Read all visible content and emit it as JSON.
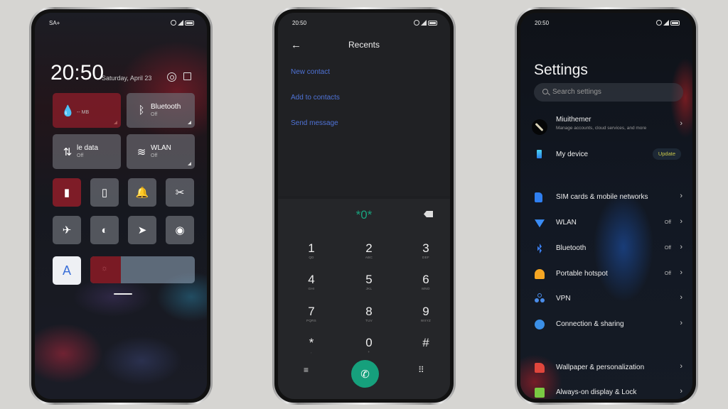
{
  "control_center": {
    "status_left": "SA+",
    "time": "20:50",
    "date": "Saturday, April 23",
    "icons": {
      "settings": "gear-icon",
      "edit": "edit-icon"
    },
    "tiles_large": [
      {
        "id": "data-usage",
        "label": "",
        "sub": "-- MB",
        "icon": "water-drop-icon",
        "active": true
      },
      {
        "id": "bluetooth",
        "label": "Bluetooth",
        "sub": "Off",
        "icon": "bluetooth-icon",
        "active": false
      },
      {
        "id": "mobile-data",
        "label": "le data",
        "sub": "Off",
        "icon": "mobile-data-icon",
        "active": false
      },
      {
        "id": "wlan",
        "label": "WLAN",
        "sub": "Off",
        "icon": "wifi-icon",
        "active": false
      }
    ],
    "tiles_small": [
      {
        "id": "vibrate",
        "glyph": "▮",
        "icon": "vibrate-icon",
        "active": true
      },
      {
        "id": "flashlight",
        "glyph": "▯",
        "icon": "flashlight-icon",
        "active": false
      },
      {
        "id": "ring",
        "glyph": "🔔",
        "icon": "bell-icon",
        "active": false
      },
      {
        "id": "screenshot",
        "glyph": "✂",
        "icon": "screenshot-icon",
        "active": false
      },
      {
        "id": "airplane",
        "glyph": "✈",
        "icon": "airplane-icon",
        "active": false
      },
      {
        "id": "dark-mode",
        "glyph": "◐",
        "icon": "dark-mode-icon",
        "active": false
      },
      {
        "id": "location",
        "glyph": "➤",
        "icon": "location-icon",
        "active": false
      },
      {
        "id": "reading-mode",
        "glyph": "◉",
        "icon": "eye-icon",
        "active": false
      }
    ],
    "auto_brightness_label": "A",
    "brightness_percent": 29,
    "brightness_icon": "☼"
  },
  "dialer": {
    "status_time": "20:50",
    "back_glyph": "←",
    "title": "Recents",
    "actions": [
      "New contact",
      "Add to contacts",
      "Send message"
    ],
    "number": "*0*",
    "keys": [
      {
        "digit": "1",
        "letters": "QD"
      },
      {
        "digit": "2",
        "letters": "ABC"
      },
      {
        "digit": "3",
        "letters": "DEF"
      },
      {
        "digit": "4",
        "letters": "GHI"
      },
      {
        "digit": "5",
        "letters": "JKL"
      },
      {
        "digit": "6",
        "letters": "MNO"
      },
      {
        "digit": "7",
        "letters": "PQRS"
      },
      {
        "digit": "8",
        "letters": "TUV"
      },
      {
        "digit": "9",
        "letters": "WXYZ"
      },
      {
        "digit": "*",
        "letters": ","
      },
      {
        "digit": "0",
        "letters": "+"
      },
      {
        "digit": "#",
        "letters": ""
      }
    ],
    "menu_glyph": "≡",
    "grid_glyph": "⠿",
    "call_glyph": "✆",
    "accent": "#16a07c",
    "link_color": "#4f73d6"
  },
  "settings": {
    "status_time": "20:50",
    "title": "Settings",
    "search_placeholder": "Search settings",
    "account": {
      "name": "Miuithemer",
      "subtitle": "Manage accounts, cloud services, and more"
    },
    "my_device": {
      "label": "My device",
      "badge": "Update"
    },
    "items": [
      {
        "label": "SIM cards & mobile networks",
        "status": "",
        "icon": "sim-card-icon",
        "color": "#2f7ff0"
      },
      {
        "label": "WLAN",
        "status": "Off",
        "icon": "wifi-icon",
        "color": "#3a8cf5"
      },
      {
        "label": "Bluetooth",
        "status": "Off",
        "icon": "bluetooth-icon",
        "color": "#3a7ef0"
      },
      {
        "label": "Portable hotspot",
        "status": "Off",
        "icon": "hotspot-icon",
        "color": "#f5a623"
      },
      {
        "label": "VPN",
        "status": "",
        "icon": "vpn-icon",
        "color": "#4a8ce8"
      },
      {
        "label": "Connection & sharing",
        "status": "",
        "icon": "connection-icon",
        "color": "#3b8fe6"
      },
      {
        "label": "Wallpaper & personalization",
        "status": "",
        "icon": "wallpaper-icon",
        "color": "#e0463c"
      },
      {
        "label": "Always-on display & Lock",
        "status": "",
        "icon": "lock-screen-icon",
        "color": "#7ac943"
      }
    ],
    "chevron": "›"
  }
}
